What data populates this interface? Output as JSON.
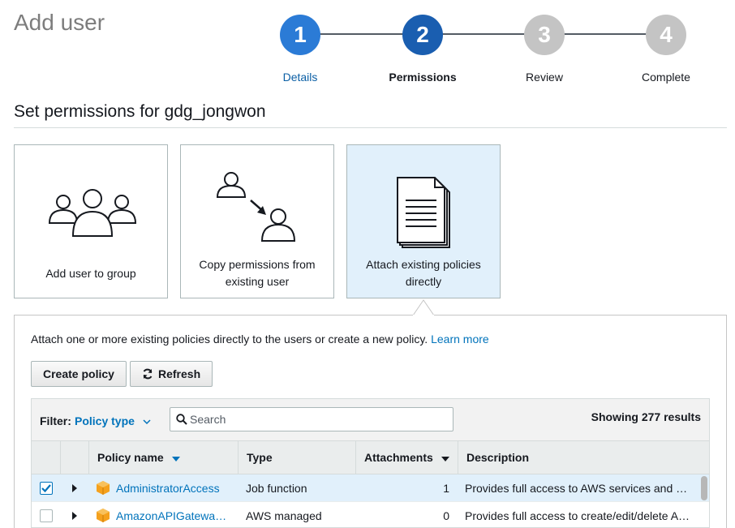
{
  "page": {
    "title": "Add user"
  },
  "wizard": {
    "steps": [
      {
        "number": "1",
        "label": "Details",
        "state": "done",
        "color": "#2b7bd6",
        "label_color": "#0b5fa5"
      },
      {
        "number": "2",
        "label": "Permissions",
        "state": "current",
        "color": "#1a5eb0",
        "label_color": "#16191f"
      },
      {
        "number": "3",
        "label": "Review",
        "state": "todo",
        "color": "#c4c4c4",
        "label_color": "#16191f"
      },
      {
        "number": "4",
        "label": "Complete",
        "state": "todo",
        "color": "#c4c4c4",
        "label_color": "#16191f"
      }
    ]
  },
  "permissions": {
    "title": "Set permissions for gdg_jongwon",
    "options": [
      {
        "label": "Add user to group",
        "icon": "user-group-icon",
        "selected": false
      },
      {
        "label": "Copy permissions from existing user",
        "icon": "copy-user-icon",
        "selected": false
      },
      {
        "label": "Attach existing policies directly",
        "icon": "documents-icon",
        "selected": true
      }
    ]
  },
  "policies_panel": {
    "description": "Attach one or more existing policies directly to the users or create a new policy.",
    "learn_more": "Learn more",
    "create_policy": "Create policy",
    "refresh": "Refresh",
    "filter_label": "Filter:",
    "filter_value": "Policy type",
    "search_placeholder": "Search",
    "results": "Showing 277 results",
    "columns": {
      "name": "Policy name",
      "type": "Type",
      "attachments": "Attachments",
      "description": "Description"
    },
    "rows": [
      {
        "name": "AdministratorAccess",
        "type": "Job function",
        "attachments": "1",
        "description": "Provides full access to AWS services and resources.",
        "checked": true
      },
      {
        "name": "AmazonAPIGatewayAdministrator",
        "type": "AWS managed",
        "attachments": "0",
        "description": "Provides full access to create/edit/delete APIs in Amazon API Gateway via the AWS Management Console.",
        "checked": false
      }
    ]
  },
  "colors": {
    "link": "#0073bb",
    "selected_bg": "#e1f0fb",
    "policy_icon": "#f5a11d"
  }
}
